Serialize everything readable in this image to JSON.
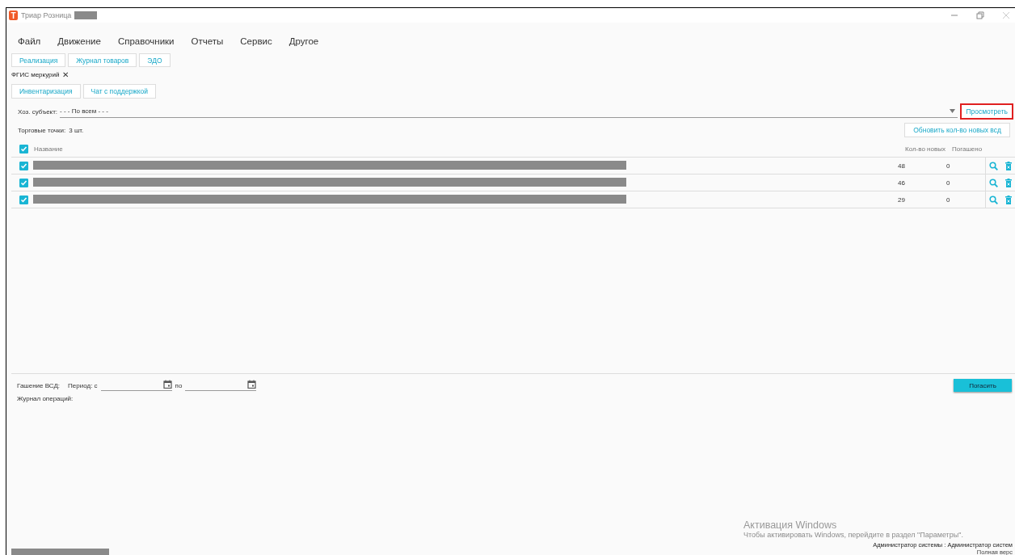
{
  "window": {
    "icon_letter": "T",
    "title": "Триар Розница"
  },
  "menu": [
    "Файл",
    "Движение",
    "Справочники",
    "Отчеты",
    "Сервис",
    "Другое"
  ],
  "toolbar": [
    "Реализация",
    "Журнал товаров",
    "ЭДО"
  ],
  "tab": {
    "label": "ФГИС меркурий",
    "close": "✕"
  },
  "actions": [
    "Инвентаризация",
    "Чат с поддержкой"
  ],
  "filter": {
    "label": "Хоз. субъект:",
    "value": "- - - По всем - - -",
    "button": "Просмотреть",
    "highlighted": true
  },
  "count": {
    "label": "Торговые точки:",
    "value": "3  шт."
  },
  "refresh_button": "Обновить кол-во новых всд",
  "table": {
    "header_checked": true,
    "columns": [
      "Название",
      "Кол-во новых",
      "Погашено"
    ],
    "rows": [
      {
        "checked": true,
        "new": "48",
        "redeemed": "0"
      },
      {
        "checked": true,
        "new": "46",
        "redeemed": "0"
      },
      {
        "checked": true,
        "new": "29",
        "redeemed": "0"
      }
    ]
  },
  "redeem": {
    "label": "Гашение ВСД:",
    "period": "Период: с",
    "to": "по",
    "button": "Погасить"
  },
  "journal_label": "Журнал операций:",
  "activation": {
    "title": "Активация Windows",
    "text": "Чтобы активировать Windows, перейдите в раздел \"Параметры\"."
  },
  "status": {
    "user": "Администратор системы : Администратор систем",
    "version": "Полная верс"
  }
}
